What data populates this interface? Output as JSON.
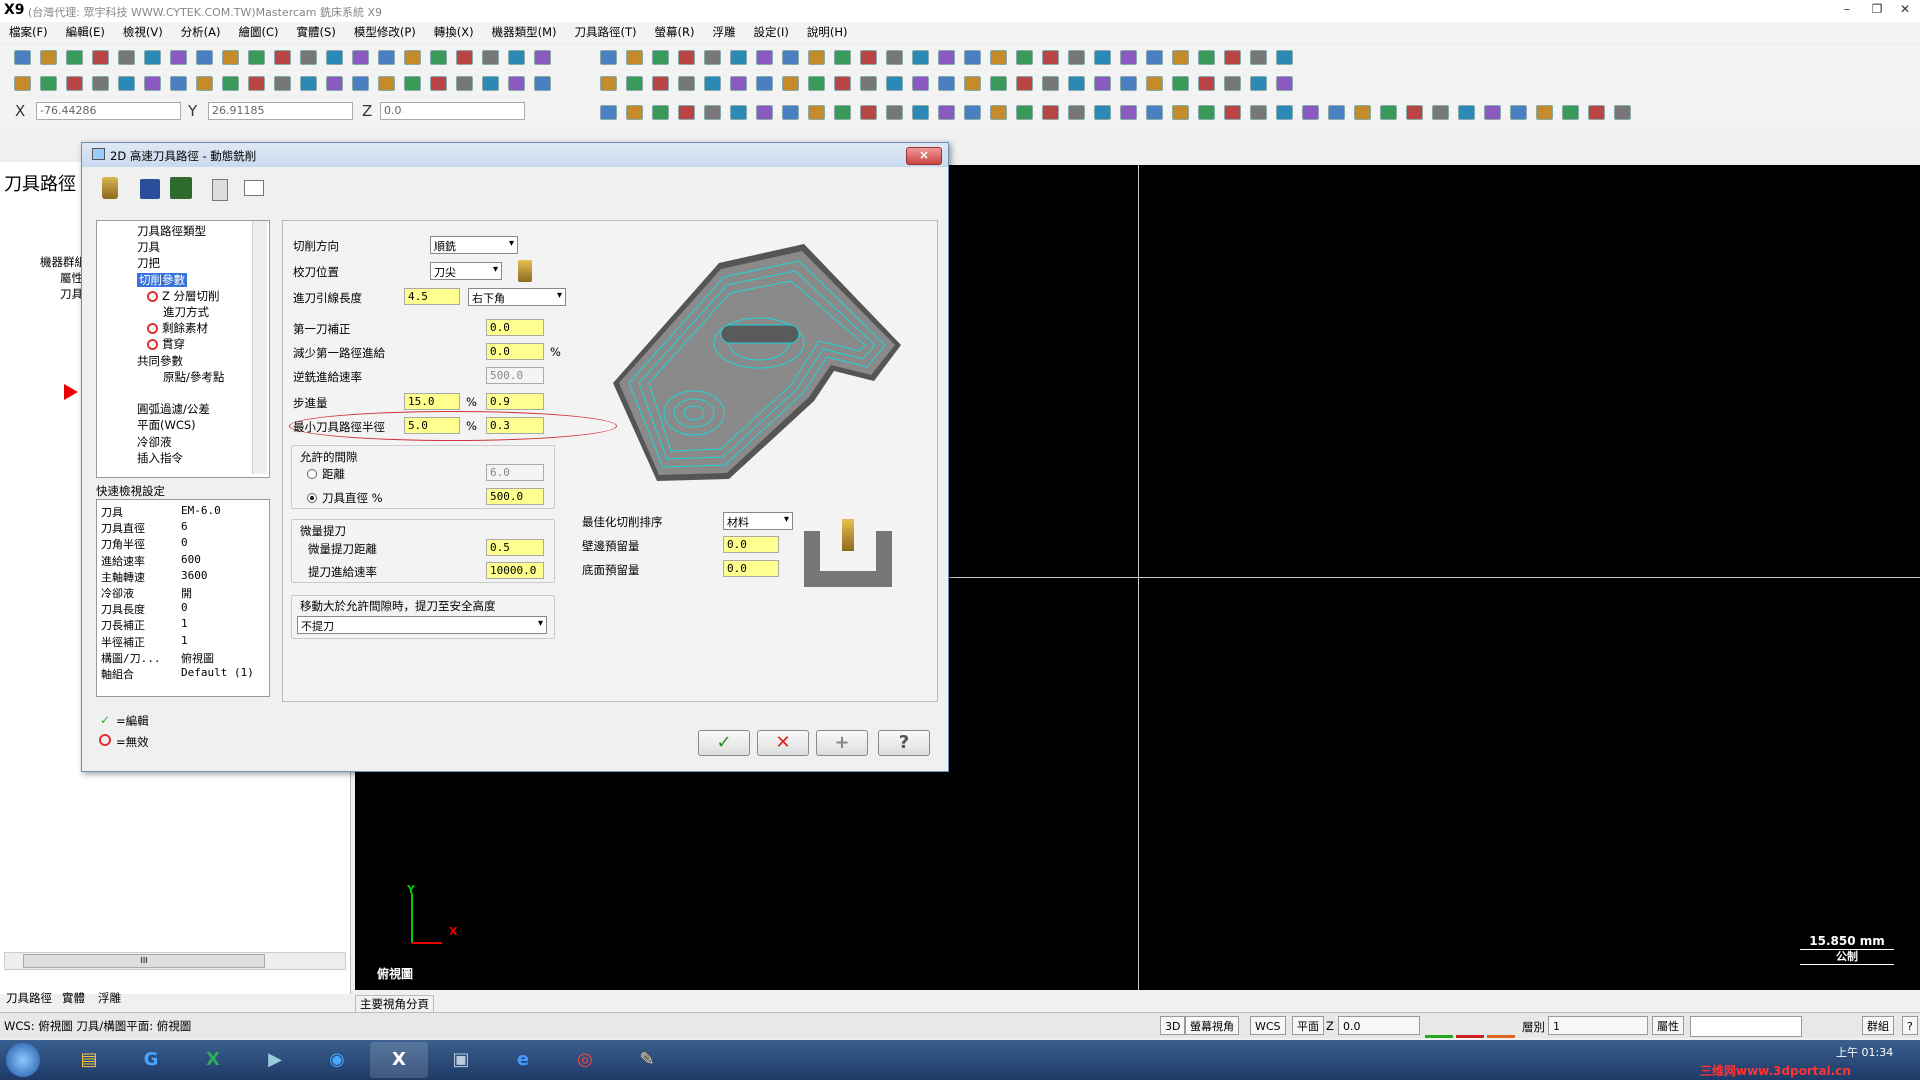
{
  "window": {
    "title": "(台灣代理: 眾宇科技 WWW.CYTEK.COM.TW)Mastercam 銑床系統 X9",
    "logo": "X9"
  },
  "menu": [
    "檔案(F)",
    "編輯(E)",
    "檢視(V)",
    "分析(A)",
    "繪圖(C)",
    "實體(S)",
    "模型修改(P)",
    "轉換(X)",
    "機器類型(M)",
    "刀具路徑(T)",
    "螢幕(R)",
    "浮雕",
    "設定(I)",
    "說明(H)"
  ],
  "coords": {
    "x_label": "X",
    "x_value": "-76.44286",
    "y_label": "Y",
    "y_value": "26.91185",
    "z_label": "Z",
    "z_value": "0.0"
  },
  "left_panel": {
    "title": "刀具路徑",
    "tree": [
      "機器群組",
      "屬性",
      "刀具群組"
    ],
    "tabs": [
      "刀具路徑",
      "實體",
      "浮雕"
    ],
    "scroll_label": "III"
  },
  "dialog": {
    "title": "2D 高速刀具路徑 - 動態銑削",
    "close": "×",
    "tree": [
      {
        "label": "刀具路徑類型",
        "level": 1,
        "mark": "none"
      },
      {
        "label": "刀具",
        "level": 1,
        "mark": "none"
      },
      {
        "label": "刀把",
        "level": 1,
        "mark": "none"
      },
      {
        "label": "切削參數",
        "level": 1,
        "mark": "selected"
      },
      {
        "label": "Z 分層切削",
        "level": 2,
        "mark": "invalid"
      },
      {
        "label": "進刀方式",
        "level": 2,
        "mark": "none"
      },
      {
        "label": "剩餘素材",
        "level": 2,
        "mark": "invalid"
      },
      {
        "label": "貫穿",
        "level": 2,
        "mark": "invalid"
      },
      {
        "label": "共同參數",
        "level": 1,
        "mark": "none"
      },
      {
        "label": "原點/參考點",
        "level": 2,
        "mark": "none"
      },
      {
        "label": "",
        "level": 1,
        "mark": "none"
      },
      {
        "label": "圓弧過濾/公差",
        "level": 1,
        "mark": "none"
      },
      {
        "label": "平面(WCS)",
        "level": 1,
        "mark": "none"
      },
      {
        "label": "冷卻液",
        "level": 1,
        "mark": "none"
      },
      {
        "label": "插入指令",
        "level": 1,
        "mark": "none"
      }
    ],
    "quick_view_title": "快速檢視設定",
    "quick_view": [
      [
        "刀具",
        "EM-6.0"
      ],
      [
        "刀具直徑",
        "6"
      ],
      [
        "刀角半徑",
        "0"
      ],
      [
        "進給速率",
        "600"
      ],
      [
        "主軸轉速",
        "3600"
      ],
      [
        "冷卻液",
        "開"
      ],
      [
        "刀具長度",
        "0"
      ],
      [
        "刀長補正",
        "1"
      ],
      [
        "半徑補正",
        "1"
      ],
      [
        "構圖/刀...",
        "俯視圖"
      ],
      [
        "軸組合",
        "Default (1)"
      ]
    ],
    "legend": {
      "edit": "=編輯",
      "invalid": "=無效"
    },
    "params": {
      "cut_dir_label": "切削方向",
      "cut_dir": "順銑",
      "tip_label": "校刀位置",
      "tip": "刀尖",
      "lead_label": "進刀引線長度",
      "lead_value": "4.5",
      "lead_corner": "右下角",
      "first_cut_label": "第一刀補正",
      "first_cut": "0.0",
      "reduce_label": "減少第一路徑進給",
      "reduce": "0.0",
      "reduce_unit": "%",
      "climb_feed_label": "逆銑進給速率",
      "climb_feed": "500.0",
      "step_label": "步進量",
      "step_pct": "15.0",
      "step_pct_unit": "%",
      "step_val": "0.9",
      "min_rad_label": "最小刀具路徑半徑",
      "min_rad_pct": "5.0",
      "min_rad_unit": "%",
      "min_rad_val": "0.3",
      "gap_title": "允許的間隙",
      "gap_dist_label": "距離",
      "gap_dist": "6.0",
      "gap_dia_label": "刀具直徑 %",
      "gap_dia": "500.0",
      "microlift_title": "微量提刀",
      "ml_dist_label": "微量提刀距離",
      "ml_dist": "0.5",
      "ml_feed_label": "提刀進給速率",
      "ml_feed": "10000.0",
      "retract_title": "移動大於允許間隙時，提刀至安全高度",
      "retract": "不提刀",
      "order_label": "最佳化切削排序",
      "order": "材料",
      "wall_label": "壁邊預留量",
      "wall": "0.0",
      "floor_label": "底面預留量",
      "floor": "0.0"
    }
  },
  "viewport": {
    "axis_y": "Y",
    "axis_x": "X",
    "view_label": "俯視圖",
    "scale": "15.850 mm",
    "unit": "公制"
  },
  "bottom_tab": "主要視角分頁",
  "status": {
    "wcs": "WCS: 俯視圖  刀具/構圖平面: 俯視圖",
    "mode": "3D",
    "view": "螢幕視角",
    "wcs_btn": "WCS",
    "plane": "平面",
    "z_lab": "Z",
    "z_val": "0.0",
    "layer_lab": "層別",
    "layer_val": "1",
    "attr": "屬性",
    "group": "群組",
    "help": "?"
  },
  "taskbar": {
    "clock": "上午 01:34",
    "watermark": "三维网www.3dportal.cn"
  },
  "colors": {
    "viewport": "#000000",
    "toolpath": "#1fd6d6",
    "part": "#7a7a7a",
    "yellow_field": "#ffff90",
    "highlight_ellipse": "#d0303a"
  }
}
